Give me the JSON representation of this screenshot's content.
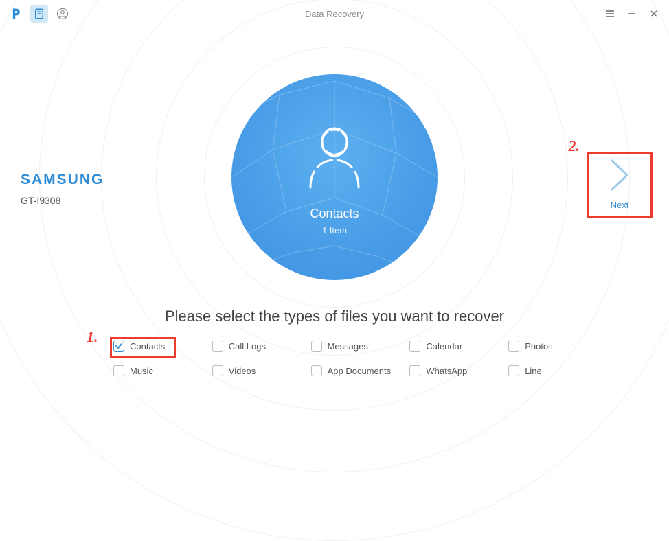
{
  "header": {
    "title": "Data Recovery"
  },
  "device": {
    "brand": "SAMSUNG",
    "model": "GT-I9308"
  },
  "center": {
    "category_label": "Contacts",
    "count_label": "1 Item"
  },
  "next": {
    "label": "Next"
  },
  "instruction": "Please select the types of files you want to recover",
  "annotations": {
    "n1": "1.",
    "n2": "2."
  },
  "options": [
    {
      "id": "contacts",
      "label": "Contacts",
      "checked": true
    },
    {
      "id": "call-logs",
      "label": "Call Logs",
      "checked": false
    },
    {
      "id": "messages",
      "label": "Messages",
      "checked": false
    },
    {
      "id": "calendar",
      "label": "Calendar",
      "checked": false
    },
    {
      "id": "photos",
      "label": "Photos",
      "checked": false
    },
    {
      "id": "music",
      "label": "Music",
      "checked": false
    },
    {
      "id": "videos",
      "label": "Videos",
      "checked": false
    },
    {
      "id": "app-documents",
      "label": "App Documents",
      "checked": false
    },
    {
      "id": "whatsapp",
      "label": "WhatsApp",
      "checked": false
    },
    {
      "id": "line",
      "label": "Line",
      "checked": false
    }
  ],
  "colors": {
    "accent": "#2d8bd6",
    "annotation": "#ee3b2f"
  }
}
